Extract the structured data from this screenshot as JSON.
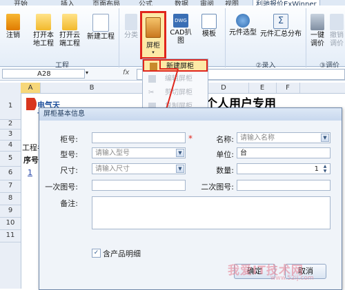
{
  "ribbon": {
    "tabs": [
      "开始",
      "插入",
      "页面布局",
      "公式",
      "数据",
      "审阅",
      "视图",
      "利驰报价ExWinner"
    ],
    "buttons": {
      "deregister": "注销",
      "open_local": "打开本地工程",
      "open_cloud": "打开云端工程",
      "new_project": "新建工程",
      "category": "分类",
      "cabinet": "屏柜",
      "cad_drawing": "CAD扒图",
      "template": "模板",
      "component_select": "元件选型",
      "component_summary": "元件汇总分布",
      "one_click": "一键调价",
      "withdraw": "撤销调价"
    },
    "groups": {
      "project": "工程",
      "entry": "②录入",
      "price": "③调价"
    }
  },
  "formula_bar": {
    "cell_ref": "A28",
    "fx": "fx"
  },
  "sheet": {
    "columns": [
      "A",
      "B",
      "C",
      "D",
      "E",
      "F"
    ],
    "rows": [
      "1",
      "2",
      "3",
      "4",
      "5",
      "6",
      "7",
      "8",
      "9",
      "10",
      "11"
    ],
    "heading": "个人用户专用",
    "cell_a4": "工程名",
    "cell_a5": "序号",
    "cell_a6": "1",
    "logo_text": "电气天下"
  },
  "menu": {
    "items": [
      "新建屏柜",
      "编辑屏柜",
      "剪切屏柜",
      "复制屏柜"
    ]
  },
  "dialog": {
    "title": "屏柜基本信息",
    "fields": {
      "cabinet_no_label": "柜号:",
      "cabinet_no_value": "",
      "required_mark": "*",
      "name_label": "名称:",
      "name_placeholder": "请输入名称",
      "model_label": "型号:",
      "model_placeholder": "请输入型号",
      "unit_label": "单位:",
      "unit_value": "台",
      "size_label": "尺寸:",
      "size_placeholder": "请输入尺寸",
      "qty_label": "数量:",
      "qty_value": "1",
      "primary_drawing_label": "一次图号:",
      "secondary_drawing_label": "二次图号:",
      "note_label": "备注:"
    },
    "checkbox_label": "含产品明细",
    "checkbox_checked": true,
    "ok_label": "确定",
    "cancel_label": "取消"
  },
  "watermark": {
    "main": "我爱IT技术网",
    "sub": "www.52ij.com"
  },
  "colors": {
    "highlight_border": "#e0251c",
    "highlight_fill": "#fde9a6",
    "arrow": "#e0251c"
  }
}
